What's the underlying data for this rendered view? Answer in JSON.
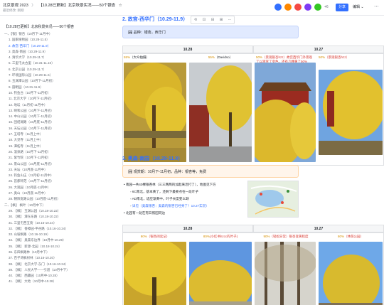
{
  "topbar": {
    "crumbs": [
      "北京景观 2023",
      "〉",
      "【10.28已更新】北京秋景实况——50个银杏",
      "☆"
    ],
    "subtitle": "最近修改: 刚刚",
    "avatar_colors": [
      "#3370ff",
      "#ff8800",
      "#f54a45",
      "#7f3bf5",
      "#34c724"
    ],
    "avatar_count": "+6",
    "share_label": "分享",
    "edit_label": "编辑 ⌄",
    "more_icon": "⋯"
  },
  "sidebar": {
    "title": "【10.28已更新】北京秋景实况——50个银杏",
    "items": [
      {
        "label": "一、【银】银杏（10月下-11月中）",
        "level": 1
      },
      {
        "label": "1. 国家植物园（10.28-11.5）",
        "level": 2
      },
      {
        "label": "2. 故宫-西华门（10.29-11.9）",
        "level": 2,
        "active": true
      },
      {
        "label": "3. 奥森-南园（10.29-11.9）",
        "level": 2
      },
      {
        "label": "4. 清华大学（10.29-11.7）",
        "level": 2
      },
      {
        "label": "5. 三里屯太古里（10.31-11.10）",
        "level": 2
      },
      {
        "label": "6. 北京公园（10.29-11.7）",
        "level": 2
      },
      {
        "label": "7. 环境国际公园（10.29-11.5）",
        "level": 2
      },
      {
        "label": "8. 玉渊潭公园（10月下-11月初）",
        "level": 2
      },
      {
        "label": "9. 圆明园（10.31-11.9）",
        "level": 2
      },
      {
        "label": "10. 钓鱼台（10月下-11月初）",
        "level": 2
      },
      {
        "label": "11. 北京大学（10月下-11月初）",
        "level": 2
      },
      {
        "label": "12. 地坛（11月初-11月中）",
        "level": 2
      },
      {
        "label": "13. 颐和公园（10月下-11月初）",
        "level": 2
      },
      {
        "label": "14. 中山公园（10月下-11月初）",
        "level": 2
      },
      {
        "label": "15. 团结湖路（10月底-11月初）",
        "level": 2
      },
      {
        "label": "16. 天坛公园（10月下-11月初）",
        "level": 2
      },
      {
        "label": "17. 五塔寺（11月上中）",
        "level": 2
      },
      {
        "label": "18. 大觉寺（11月上中）",
        "level": 2
      },
      {
        "label": "19. 潭柘寺（11月上中）",
        "level": 2
      },
      {
        "label": "20. 温泉路（10月下-11月初）",
        "level": 2
      },
      {
        "label": "21. 紫竹院（10月下-11月初）",
        "level": 2
      },
      {
        "label": "22. 景山公园（10月底-11月初）",
        "level": 2
      },
      {
        "label": "23. 天坛（10月底-11月中）",
        "level": 2
      },
      {
        "label": "24. 钓鱼山庄（11月初-11月中）",
        "level": 2
      },
      {
        "label": "25. 首都师范（10月下-11月初）",
        "level": 2
      },
      {
        "label": "26. 大观园（10月底-11月中）",
        "level": 2
      },
      {
        "label": "27. 奥山（10月底-11月中）",
        "level": 2
      },
      {
        "label": "28. 朝阳宽路公园（10月底-11月初）",
        "level": 2
      },
      {
        "label": "二、【枫】 枫叶（10月中下）",
        "level": 1
      },
      {
        "label": "29. 【枫】 玉渊公园（10.18-10.22）",
        "level": 2
      },
      {
        "label": "30. 【枫】 潭东东路（10.18-10.22）",
        "level": 2
      },
      {
        "label": "31. 三里屯西五街（10.16-10.24）",
        "level": 2
      },
      {
        "label": "32. 【枫】 香樟园-平谷路（10.16-10.24）",
        "level": 2
      },
      {
        "label": "33. 山坡枫路（10.16-10.19）",
        "level": 2
      },
      {
        "label": "34. 【枫】 奥森东边界（10月中-10.29）",
        "level": 2
      },
      {
        "label": "35. 【枫】 新源-北园（10.18-10.24）",
        "level": 2
      },
      {
        "label": "36. 东四枫路林（10月中下）",
        "level": 2
      },
      {
        "label": "37. 百子湾枫树林（10.16-10.20）",
        "level": 2
      },
      {
        "label": "38. 【枫】 北京大学-东门（10.16-10.24）",
        "level": 2
      },
      {
        "label": "39. 【枫】 人民大学——引道（10月中下）",
        "level": 2
      },
      {
        "label": "40. 【枫】 西藏园（10月中-10.28）",
        "level": 2
      },
      {
        "label": "41. 【枫】 大地（10月中-10.28）",
        "level": 2
      }
    ]
  },
  "main": {
    "section2": {
      "title": "2. 故宫-西华门（10.29-11.9）",
      "toolbar": [
        "⟲",
        "⊡",
        "⊟",
        "⊞",
        "⋯"
      ],
      "callout_icon": "🏞",
      "callout": "品种：银杏，西华门",
      "dates": [
        "10.28",
        "10.27"
      ],
      "captions": [
        {
          "pct": "55%",
          "text": "（大众拍摄）"
        },
        {
          "pct": "55%",
          "text": "（Davidso）"
        },
        {
          "pct": "50%",
          "text": "（景观银杏hzz）故宫西华门外景观了以观赏了变色，还有几棵黄了50%"
        },
        {
          "pct": "50%",
          "text": "（景观银杏hzz）"
        }
      ]
    },
    "section3": {
      "title": "3. 奥森-南园（10.29-11.9）",
      "callout_icon": "🏞",
      "callout": "观赏期：10月下-11月初，品种：银杏等，免费",
      "bullets": [
        {
          "text": "南园一共40棵银杏林（三三两两的加起来近打了），地图见下方",
          "level": 1
        },
        {
          "text": "6C南北，基本黄了，还剩下最要点在一段叶子",
          "level": 2
        },
        {
          "text": "AD南北，适应渐黄中，叶子长度变么缺",
          "level": 2
        },
        {
          "text": "详见（奥森银杏：奥森的银杏已经秀了！10.27实况）",
          "level": 2,
          "link": true
        },
        {
          "text": "北园有一处在有日照园同边",
          "level": 1
        }
      ],
      "dates": [
        "10.28",
        "10.27"
      ],
      "captions": [
        {
          "pct": "90%",
          "text": "（银杏阅读记）"
        },
        {
          "pct": "80%",
          "text": "(小红书hzcc的叶子)"
        },
        {
          "pct": "90%",
          "text": "（轻松日常）银杏变黄程度"
        },
        {
          "pct": "80%",
          "text": "（林荫公园）"
        }
      ]
    }
  }
}
